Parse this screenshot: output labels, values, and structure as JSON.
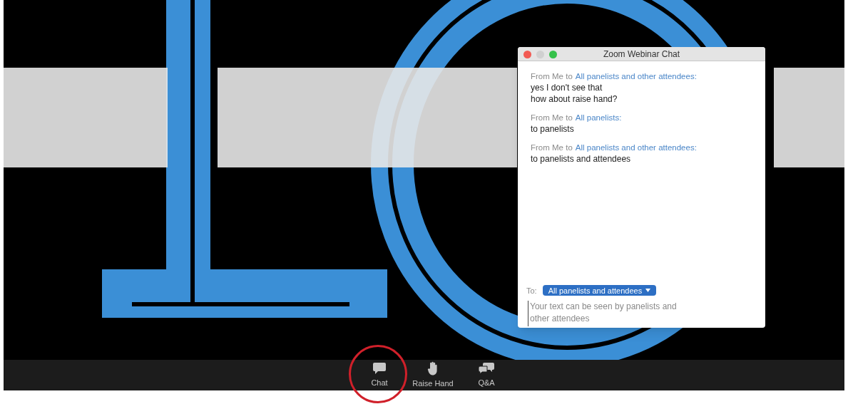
{
  "chat_window": {
    "title": "Zoom Webinar Chat",
    "messages": [
      {
        "sender": "From Me to",
        "recipient": "All panelists and other attendees:",
        "lines": [
          "yes I don't see that",
          "how about raise hand?"
        ]
      },
      {
        "sender": "From Me to",
        "recipient": "All panelists:",
        "lines": [
          "to panelists"
        ]
      },
      {
        "sender": "From Me to",
        "recipient": "All panelists and other attendees:",
        "lines": [
          "to panelists and attendees"
        ]
      }
    ],
    "to_label": "To:",
    "recipient_dropdown": "All panelists and attendees",
    "input": {
      "placeholder": "Your text can be seen by panelists and\nother attendees"
    }
  },
  "toolbar": [
    {
      "kind": "chat",
      "label": "Chat",
      "highlighted": true
    },
    {
      "kind": "hand",
      "label": "Raise Hand",
      "highlighted": false
    },
    {
      "kind": "qa",
      "label": "Q&A",
      "highlighted": false
    }
  ]
}
